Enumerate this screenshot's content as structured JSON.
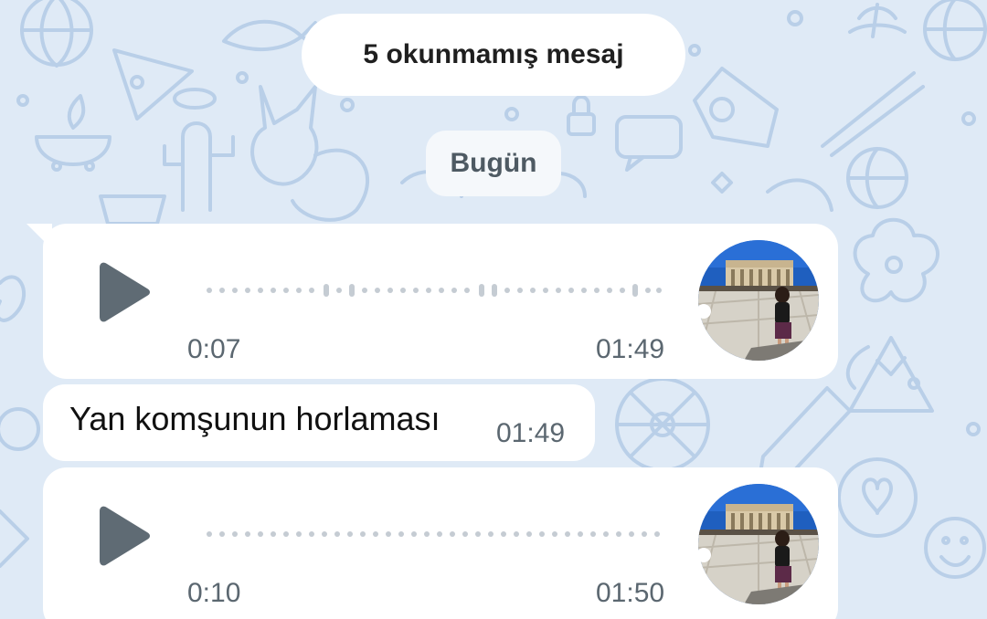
{
  "colors": {
    "wallpaper": "#dfeaf6",
    "pattern": "#b9cfe8",
    "bubble": "#ffffff",
    "play_icon": "#5f6b74",
    "meta_text": "#5b6770"
  },
  "unread_banner": {
    "label": "5 okunmamış mesaj"
  },
  "date_separator": {
    "label": "Bugün"
  },
  "messages": [
    {
      "kind": "voice",
      "icon": "play-icon",
      "duration": "0:07",
      "time": "01:49",
      "avatar": "photo-avatar"
    },
    {
      "kind": "text",
      "text": "Yan komşunun horlaması",
      "time": "01:49"
    },
    {
      "kind": "voice",
      "icon": "play-icon",
      "duration": "0:10",
      "time": "01:50",
      "avatar": "photo-avatar"
    }
  ]
}
